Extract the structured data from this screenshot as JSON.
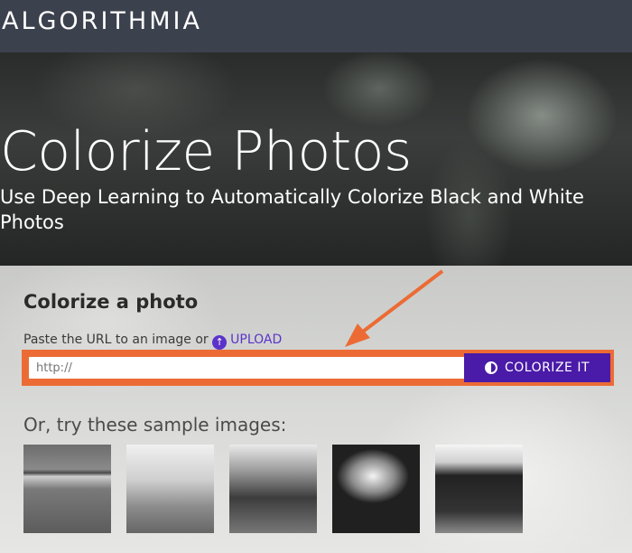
{
  "header": {
    "logo_text": "ALGORITHMIA"
  },
  "hero": {
    "title": "Colorize Photos",
    "subtitle": "Use Deep Learning to Automatically Colorize Black and White Photos"
  },
  "form": {
    "title": "Colorize a photo",
    "paste_text": "Paste the URL to an image or",
    "upload_label": "UPLOAD",
    "url_placeholder": "http://",
    "button_label": "COLORIZE IT",
    "highlight_color": "#ec6b35",
    "button_color": "#4a1aa8"
  },
  "samples": {
    "title": "Or, try these sample images:",
    "images": [
      {
        "name": "sample-image-beach-bird"
      },
      {
        "name": "sample-image-race-car"
      },
      {
        "name": "sample-image-mountain"
      },
      {
        "name": "sample-image-people"
      },
      {
        "name": "sample-image-cows"
      }
    ]
  }
}
